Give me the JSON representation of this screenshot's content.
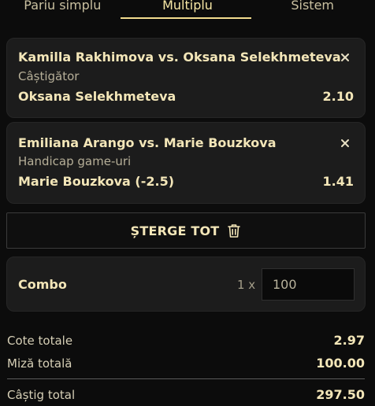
{
  "tabs": [
    {
      "label": "Pariu simplu"
    },
    {
      "label": "Multiplu"
    },
    {
      "label": "Sistem"
    }
  ],
  "bets": [
    {
      "match": "Kamilla Rakhimova vs. Oksana Selekhmeteva",
      "market": "Câștigător",
      "selection": "Oksana Selekhmeteva",
      "odds": "2.10"
    },
    {
      "match": "Emiliana Arango vs. Marie Bouzkova",
      "market": "Handicap game-uri",
      "selection": "Marie Bouzkova (-2.5)",
      "odds": "1.41"
    }
  ],
  "clear_all": {
    "label": "ȘTERGE TOT",
    "icon": "trash-icon"
  },
  "combo": {
    "label": "Combo",
    "multiplier": "1 x",
    "stake_value": "100"
  },
  "summary": {
    "total_odds_label": "Cote totale",
    "total_odds": "2.97",
    "total_stake_label": "Miză totală",
    "total_stake": "100.00",
    "total_win_label": "Câștig total",
    "total_win": "297.50"
  },
  "colors": {
    "accent": "#f2dc8f",
    "background": "#0c0c0c",
    "card": "#1c1c1c"
  }
}
